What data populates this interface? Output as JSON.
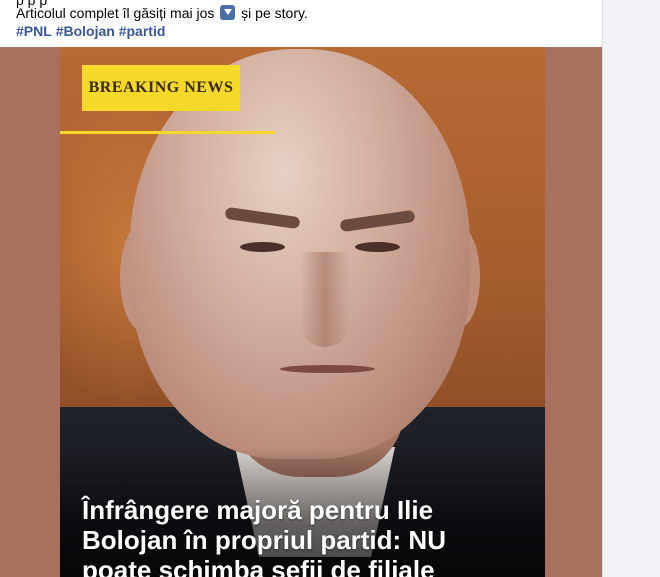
{
  "post": {
    "cutoff_text": "p          p              p",
    "text_before_emoji": "Articolul complet îl găsiți mai jos ",
    "emoji_icon": "down-arrow-emoji-icon",
    "text_after_emoji": " și pe story.",
    "hashtags": [
      "#PNL",
      "#Bolojan",
      "#partid"
    ]
  },
  "media": {
    "badge_text": "BREAKING NEWS",
    "headline_lines": [
      "Înfrângere majoră pentru Ilie",
      "Bolojan în propriul partid: NU",
      "poate schimba șefii de filiale"
    ],
    "colors": {
      "badge": "#f4d82a",
      "frame": "#a8705e",
      "background": "#b86a34"
    }
  }
}
